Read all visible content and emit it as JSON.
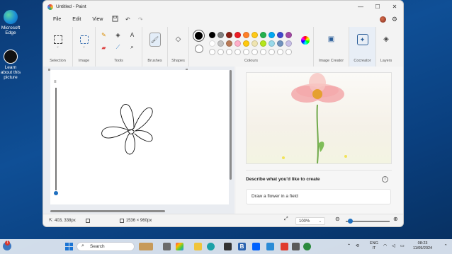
{
  "desktop": {
    "icons": [
      {
        "label": "Microsoft Edge",
        "icon": "edge-icon"
      },
      {
        "label": "Learn about this picture",
        "icon": "learn-about-picture-icon"
      }
    ]
  },
  "window": {
    "title": "Untitled - Paint",
    "controls": {
      "minimize": "—",
      "maximize": "☐",
      "close": "✕"
    }
  },
  "menu": {
    "file": "File",
    "edit": "Edit",
    "view": "View"
  },
  "ribbon": {
    "groups": {
      "selection": "Selection",
      "image": "Image",
      "tools": "Tools",
      "brushes": "Brushes",
      "shapes": "Shapes",
      "colours": "Colours",
      "image_creator": "Image Creator",
      "cocreator": "Cocreator",
      "layers": "Layers"
    },
    "palette_row1": [
      "#000000",
      "#7f7f7f",
      "#882015",
      "#ec1c24",
      "#ff7f27",
      "#ffca18",
      "#22b14c",
      "#00a8f3",
      "#3f48cc",
      "#a349a4"
    ],
    "palette_row2": [
      "#ffffff",
      "#c3c3c3",
      "#b97a56",
      "#ffaec9",
      "#ffc90e",
      "#efe4b0",
      "#b5e61d",
      "#99d9ea",
      "#7092be",
      "#c8bfe7"
    ]
  },
  "cocreator": {
    "prompt_label": "Describe what you'd like to create",
    "prompt_value": "Draw a flower in a field"
  },
  "status": {
    "cursor_pos": "403, 338px",
    "canvas_size": "1536 × 960px",
    "zoom": "100%"
  },
  "taskbar": {
    "search_placeholder": "Search",
    "notification_count": "1",
    "lang_line1": "ENG",
    "lang_line2": "IT",
    "time": "08:23",
    "date": "11/09/2024"
  }
}
